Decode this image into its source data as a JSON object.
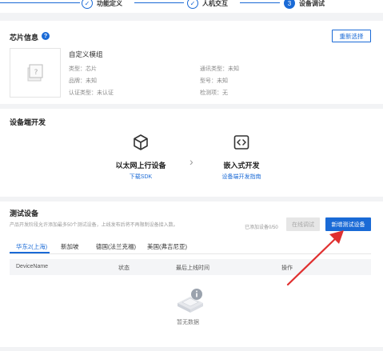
{
  "steps": [
    {
      "label": "功能定义",
      "marker": "✓"
    },
    {
      "label": "人机交互",
      "marker": "✓"
    },
    {
      "label": "设备调试",
      "marker": "3"
    }
  ],
  "chip": {
    "title": "芯片信息",
    "help": "?",
    "reselect": "重新选择",
    "module_name": "自定义模组",
    "left": [
      {
        "label": "类型",
        "value": "芯片"
      },
      {
        "label": "品牌",
        "value": "未知"
      },
      {
        "label": "认证类型",
        "value": "未认证"
      }
    ],
    "right": [
      {
        "label": "通讯类型",
        "value": "未知"
      },
      {
        "label": "型号",
        "value": "未知"
      },
      {
        "label": "检测项",
        "value": "无"
      }
    ]
  },
  "device_dev": {
    "title": "设备端开发",
    "ethernet": {
      "title": "以太网上行设备",
      "link": "下载SDK"
    },
    "embedded": {
      "title": "嵌入式开发",
      "link": "设备端开发指南"
    },
    "arrow": "›"
  },
  "test_devices": {
    "title": "测试设备",
    "description": "产品开发阶段允许添加最多50个测试设备，上线发布后将不再限制设备接入数。",
    "count_text": "已添加设备0/50",
    "online_debug": "在线调试",
    "new_device": "新增测试设备",
    "tabs": [
      "华东2(上海)",
      "新加坡",
      "德国(法兰克福)",
      "美国(弗吉尼亚)"
    ],
    "columns": [
      "DeviceName",
      "状态",
      "最后上线时间",
      "操作"
    ],
    "empty": "暂无数据"
  },
  "colors": {
    "accent": "#1a6ad6",
    "annotation_arrow": "#e03030"
  }
}
